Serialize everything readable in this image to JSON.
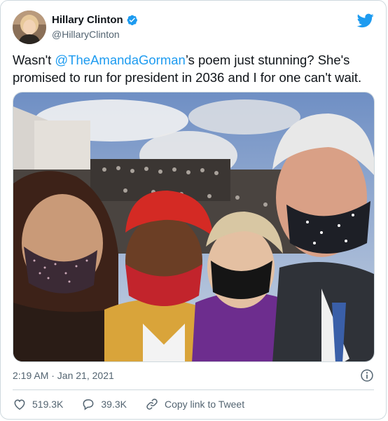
{
  "author": {
    "name": "Hillary Clinton",
    "handle": "@HillaryClinton"
  },
  "tweet": {
    "text_before": "Wasn't ",
    "mention": "@TheAmandaGorman",
    "text_after": "’s poem just stunning? She's promised to run for president in 2036 and I for one can't wait.",
    "timestamp": "2:19 AM · Jan 21, 2021"
  },
  "actions": {
    "like_count": "519.3K",
    "reply_count": "39.3K",
    "copy_link_label": "Copy link to Tweet"
  },
  "colors": {
    "accent": "#1d9bf0",
    "like": "#f91880",
    "text": "#0f1419",
    "secondary": "#536471"
  },
  "icons": [
    "verified-badge-icon",
    "twitter-bird-icon",
    "info-icon",
    "heart-icon",
    "reply-icon",
    "link-icon"
  ]
}
